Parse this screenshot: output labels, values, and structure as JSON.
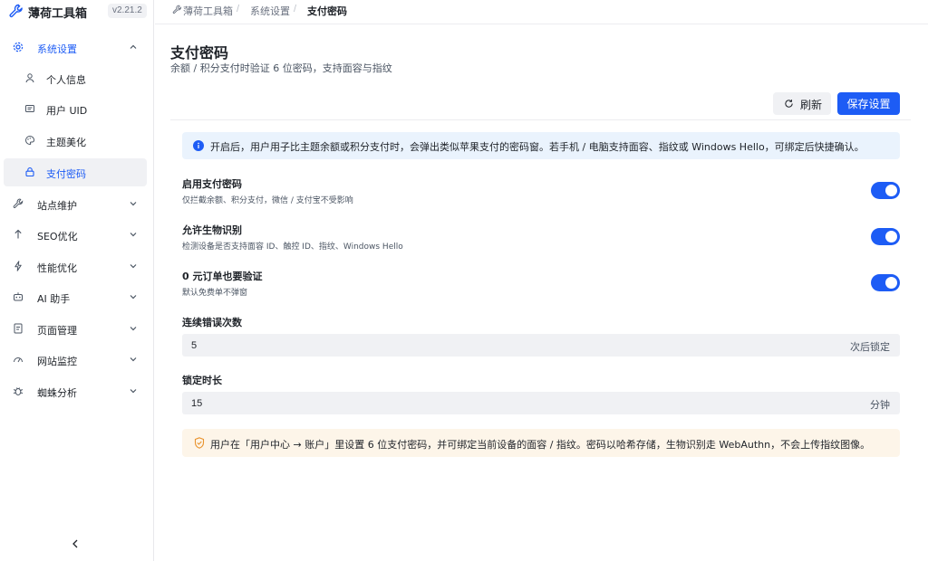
{
  "brand": {
    "name": "薄荷工具箱",
    "version": "v2.21.2"
  },
  "sidebar": {
    "group": {
      "label": "系统设置"
    },
    "sub_items": [
      {
        "label": "个人信息",
        "icon": "user-icon"
      },
      {
        "label": "用户 UID",
        "icon": "id-card-icon"
      },
      {
        "label": "主题美化",
        "icon": "palette-icon"
      },
      {
        "label": "支付密码",
        "icon": "lock-icon",
        "active": true
      }
    ],
    "items": [
      {
        "label": "站点维护",
        "icon": "wrench-icon"
      },
      {
        "label": "SEO优化",
        "icon": "arrow-up-icon"
      },
      {
        "label": "性能优化",
        "icon": "lightning-icon"
      },
      {
        "label": "AI 助手",
        "icon": "robot-icon"
      },
      {
        "label": "页面管理",
        "icon": "document-icon"
      },
      {
        "label": "网站监控",
        "icon": "gauge-icon"
      },
      {
        "label": "蜘蛛分析",
        "icon": "bug-icon"
      }
    ]
  },
  "breadcrumb": {
    "root": "薄荷工具箱",
    "section": "系统设置",
    "current": "支付密码"
  },
  "page": {
    "title": "支付密码",
    "subtitle": "余额 / 积分支付时验证 6 位密码，支持面容与指纹"
  },
  "toolbar": {
    "refresh_label": "刷新",
    "save_label": "保存设置"
  },
  "info": {
    "text": "开启后，用户用子比主题余额或积分支付时，会弹出类似苹果支付的密码窗。若手机 / 电脑支持面容、指纹或 Windows Hello，可绑定后快捷确认。"
  },
  "settings": [
    {
      "title": "启用支付密码",
      "desc": "仅拦截余额、积分支付，微信 / 支付宝不受影响",
      "enabled": true
    },
    {
      "title": "允许生物识别",
      "desc": "检测设备是否支持面容 ID、触控 ID、指纹、Windows Hello",
      "enabled": true
    },
    {
      "title": "0 元订单也要验证",
      "desc": "默认免费单不弹窗",
      "enabled": true
    }
  ],
  "fields": {
    "error_limit": {
      "label": "连续错误次数",
      "value": "5",
      "unit": "次后锁定"
    },
    "lock_duration": {
      "label": "锁定时长",
      "value": "15",
      "unit": "分钟"
    }
  },
  "notice": {
    "text": "用户在「用户中心 → 账户」里设置 6 位支付密码，并可绑定当前设备的面容 / 指纹。密码以哈希存储，生物识别走 WebAuthn，不会上传指纹图像。"
  },
  "colors": {
    "accent": "#1d5cf5",
    "info_bg": "#eaf3fd",
    "warning_bg": "#fdf5e9",
    "warning_icon": "#e8922c"
  }
}
